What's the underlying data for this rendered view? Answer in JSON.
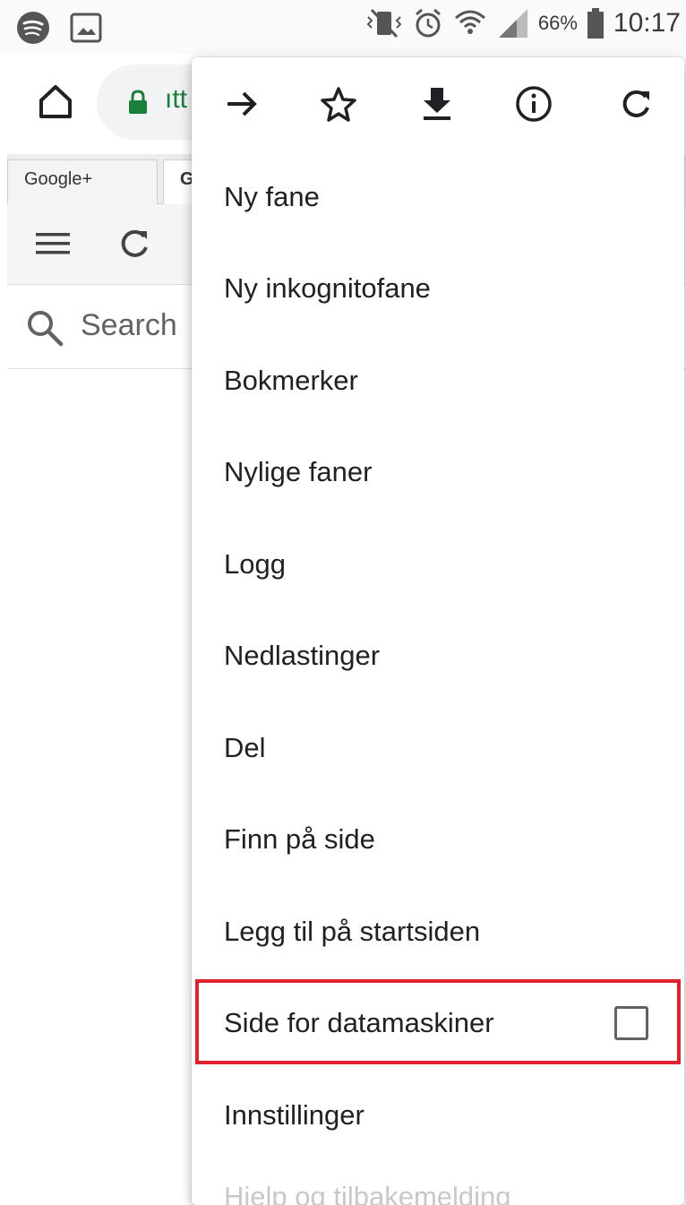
{
  "status_bar": {
    "battery_percent": "66%",
    "time": "10:17"
  },
  "browser": {
    "url_fragment": "ıtt",
    "tabs": [
      {
        "label": "Google+"
      },
      {
        "label": "G"
      }
    ],
    "search_placeholder": "Search"
  },
  "menu": {
    "icon_row": [
      {
        "name": "forward-icon"
      },
      {
        "name": "bookmark-star-icon"
      },
      {
        "name": "download-icon"
      },
      {
        "name": "info-icon"
      },
      {
        "name": "reload-icon"
      }
    ],
    "items": [
      {
        "label": "Ny fane"
      },
      {
        "label": "Ny inkognitofane"
      },
      {
        "label": "Bokmerker"
      },
      {
        "label": "Nylige faner"
      },
      {
        "label": "Logg"
      },
      {
        "label": "Nedlastinger"
      },
      {
        "label": "Del"
      },
      {
        "label": "Finn på side"
      },
      {
        "label": "Legg til på startsiden"
      },
      {
        "label": "Side for datamaskiner",
        "checked": false
      },
      {
        "label": "Innstillinger"
      },
      {
        "label": "Hjelp og tilbakemelding"
      }
    ]
  },
  "colors": {
    "highlight": "#e0212e",
    "url_green": "#188038"
  }
}
